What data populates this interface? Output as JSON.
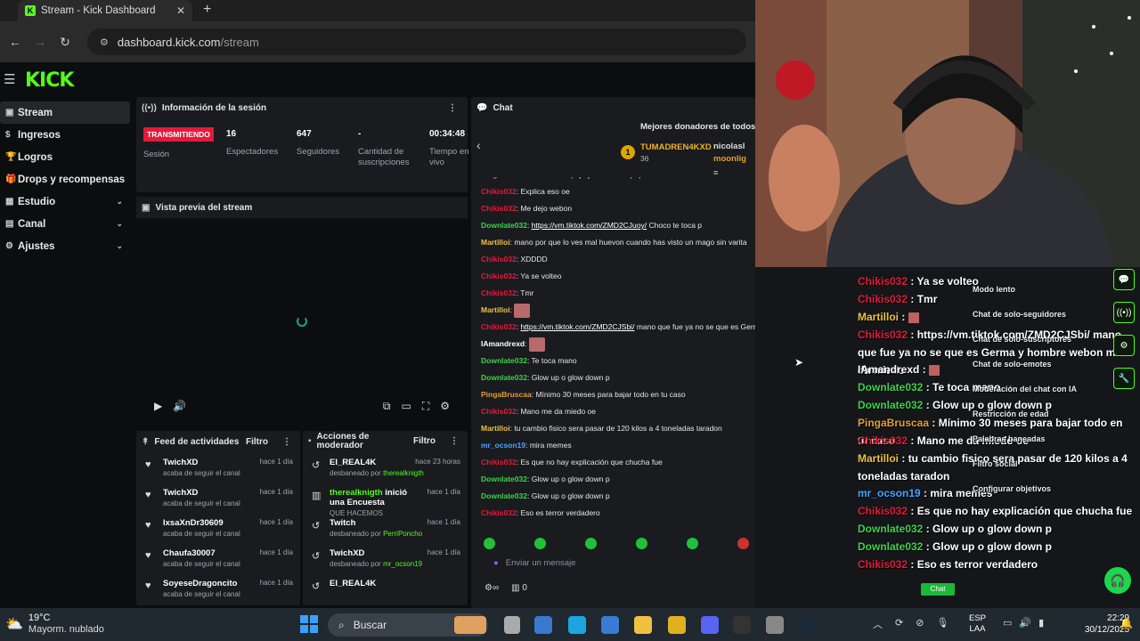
{
  "browser": {
    "tab_title": "Stream - Kick Dashboard",
    "url_host": "dashboard.kick.com",
    "url_path": "/stream"
  },
  "sidebar": {
    "items": [
      {
        "label": "Stream",
        "active": true
      },
      {
        "label": "Ingresos"
      },
      {
        "label": "Logros"
      },
      {
        "label": "Drops y recompensas"
      },
      {
        "label": "Estudio",
        "chevron": true
      },
      {
        "label": "Canal",
        "chevron": true
      },
      {
        "label": "Ajustes",
        "chevron": true
      }
    ]
  },
  "session": {
    "title": "Información de la sesión",
    "live_badge": "TRANSMITIENDO",
    "session_label": "Sesión",
    "stats": [
      {
        "value": "16",
        "label": "Espectadores"
      },
      {
        "value": "647",
        "label": "Seguidores"
      },
      {
        "value": "-",
        "label": "Cantidad de suscripciones"
      },
      {
        "value": "00:34:48",
        "label": "Tiempo en vivo"
      }
    ]
  },
  "preview": {
    "title": "Vista previa del stream"
  },
  "feed": {
    "title": "Feed de actividades",
    "filter": "Filtro",
    "items": [
      {
        "name": "TwichXD",
        "sub": "acaba de seguir el canal",
        "time": "hace 1 día"
      },
      {
        "name": "TwichXD",
        "sub": "acaba de seguir el canal",
        "time": "hace 1 día"
      },
      {
        "name": "IxsaXnDr30609",
        "sub": "acaba de seguir el canal",
        "time": "hace 1 día"
      },
      {
        "name": "Chaufa30007",
        "sub": "acaba de seguir el canal",
        "time": "hace 1 día"
      },
      {
        "name": "SoyeseDragoncito",
        "sub": "acaba de seguir el canal",
        "time": "hace 1 día"
      }
    ]
  },
  "mods": {
    "title": "Acciones de moderador",
    "filter": "Filtro",
    "items": [
      {
        "name": "El_REAL4K",
        "sub": "desbaneado por",
        "by": "therealknigth",
        "time": "hace 23 horas"
      },
      {
        "name": "therealknigth",
        "suffix": "inició una Encuesta",
        "sub": "QUE HACEMOS",
        "time": "hace 1 día"
      },
      {
        "name": "Twitch",
        "sub": "desbaneado por",
        "by": "PerriPoncho",
        "time": "hace 1 día"
      },
      {
        "name": "TwichXD",
        "sub": "desbaneado por",
        "by": "mr_ocson19",
        "time": "hace 1 día"
      },
      {
        "name": "El_REAL4K",
        "sub": "",
        "time": ""
      }
    ]
  },
  "chat": {
    "title": "Chat",
    "donors_title": "Mejores donadores de todos lo",
    "top_donor": {
      "rank": "1",
      "name": "TUMADREN4KXD",
      "amount": "36"
    },
    "other_donors": [
      "nicolasl",
      "moonlig"
    ],
    "messages": [
      {
        "user": "PingaBruscaa",
        "color": "#e0a030",
        "text": "Mira un espejo y verás un hipopótamo mano"
      },
      {
        "user": "Chikis032",
        "color": "#e31b3a",
        "text": "Explica eso oe"
      },
      {
        "user": "Chikis032",
        "color": "#e31b3a",
        "text": "Me dejo webon"
      },
      {
        "user": "Downlate032",
        "color": "#3fd24a",
        "text": "Choco te toca p",
        "link": "https://vm.tiktok.com/ZMD2CJuoy/"
      },
      {
        "user": "Martilloi",
        "color": "#f0c040",
        "text": "mano por que lo ves mal huevon cuando has visto un mago sin varita"
      },
      {
        "user": "Chikis032",
        "color": "#e31b3a",
        "text": "XDDDD"
      },
      {
        "user": "Chikis032",
        "color": "#e31b3a",
        "text": "Ya se volteo"
      },
      {
        "user": "Chikis032",
        "color": "#e31b3a",
        "text": "Tmr"
      },
      {
        "user": "Martilloi",
        "color": "#f0c040",
        "text": ""
      },
      {
        "user": "Chikis032",
        "color": "#e31b3a",
        "link": "https://vm.tiktok.com/ZMD2CJSbi/",
        "text": "mano que fue ya no se que es Germa y hombre webon me da miedo"
      },
      {
        "user": "IAmandrexd",
        "color": "#ffffff",
        "text": ""
      },
      {
        "user": "Downlate032",
        "color": "#3fd24a",
        "text": "Te toca mano"
      },
      {
        "user": "Downlate032",
        "color": "#3fd24a",
        "text": "Glow up o glow down p"
      },
      {
        "user": "PingaBruscaa",
        "color": "#e0a030",
        "text": "Mínimo 30 meses para bajar todo en tu caso"
      },
      {
        "user": "Chikis032",
        "color": "#e31b3a",
        "text": "Mano me da miedo oe"
      },
      {
        "user": "Martilloi",
        "color": "#f0c040",
        "text": "tu cambio fisico sera pasar de 120 kilos a 4 toneladas taradon"
      },
      {
        "user": "mr_ocson19",
        "color": "#4aa3ff",
        "text": "mira memes"
      },
      {
        "user": "Chikis032",
        "color": "#e31b3a",
        "text": "Es que no hay explicación que chucha fue"
      },
      {
        "user": "Downlate032",
        "color": "#3fd24a",
        "text": "Glow up o glow down p"
      },
      {
        "user": "Downlate032",
        "color": "#3fd24a",
        "text": "Glow up o glow down p"
      },
      {
        "user": "Chikis032",
        "color": "#e31b3a",
        "text": "Eso es terror verdadero"
      }
    ],
    "input_placeholder": "Enviar un mensaje",
    "footer_count": "0"
  },
  "overlay": {
    "messages": [
      {
        "user": "Chikis032",
        "color": "#e31b3a",
        "text": "Ya se volteo"
      },
      {
        "user": "Chikis032",
        "color": "#e31b3a",
        "text": "Tmr"
      },
      {
        "user": "Martilloi",
        "color": "#f0c040",
        "text": ""
      },
      {
        "user": "Chikis032",
        "color": "#e31b3a",
        "text": "https://vm.tiktok.com/ZMD2CJSbi/ mano que fue ya no se que es Germa y hombre webon me da miedo"
      },
      {
        "user": "IAmandrexd",
        "color": "#ffffff",
        "text": ""
      },
      {
        "user": "Downlate032",
        "color": "#3fd24a",
        "text": "Te toca mano"
      },
      {
        "user": "Downlate032",
        "color": "#3fd24a",
        "text": "Glow up o glow down p"
      },
      {
        "user": "PingaBruscaa",
        "color": "#e0a030",
        "text": "Mínimo 30 meses para bajar todo en tu caso"
      },
      {
        "user": "Chikis032",
        "color": "#e31b3a",
        "text": "Mano me da miedo oe"
      },
      {
        "user": "Martilloi",
        "color": "#f0c040",
        "text": "tu cambio fisico sera pasar de 120 kilos a 4 toneladas taradon"
      },
      {
        "user": "mr_ocson19",
        "color": "#4aa3ff",
        "text": "mira memes"
      },
      {
        "user": "Chikis032",
        "color": "#e31b3a",
        "text": "Es que no hay explicación que chucha fue"
      },
      {
        "user": "Downlate032",
        "color": "#3fd24a",
        "text": "Glow up o glow down p"
      },
      {
        "user": "Downlate032",
        "color": "#3fd24a",
        "text": "Glow up o glow down p"
      },
      {
        "user": "Chikis032",
        "color": "#e31b3a",
        "text": "Eso es terror verdadero"
      }
    ],
    "menu": [
      "Modo lento",
      "Chat de solo-seguidores",
      "Chat de solo-suscriptores",
      "Chat de solo-emotes",
      "Moderación del chat con IA",
      "Restricción de edad",
      "Palabras baneadas",
      "Filtro social",
      "Configurar objetivos"
    ],
    "chat_button": "Chat"
  },
  "taskbar": {
    "temp": "19°C",
    "weather": "Mayorm. nublado",
    "search": "Buscar",
    "lang1": "ESP",
    "lang2": "LAA",
    "time": "22:29",
    "date": "30/12/2025"
  },
  "colors": {
    "brand": "#53fc18",
    "live": "#e31b3a"
  }
}
